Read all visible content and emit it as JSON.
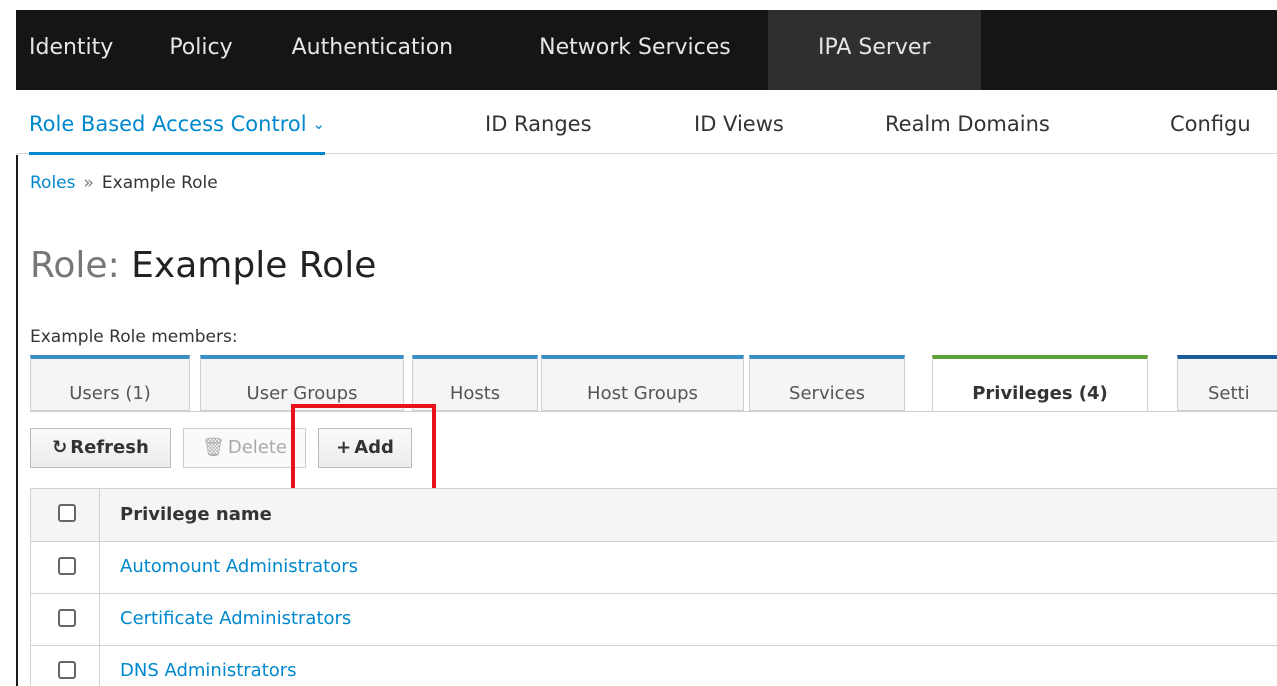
{
  "topnav": {
    "items": [
      {
        "label": "Identity"
      },
      {
        "label": "Policy"
      },
      {
        "label": "Authentication"
      },
      {
        "label": "Network Services"
      },
      {
        "label": "IPA Server"
      }
    ],
    "active": "IPA Server"
  },
  "subnav": {
    "items": [
      {
        "label": "Role Based Access Control"
      },
      {
        "label": "ID Ranges"
      },
      {
        "label": "ID Views"
      },
      {
        "label": "Realm Domains"
      },
      {
        "label": "Configu"
      }
    ],
    "active": "Role Based Access Control"
  },
  "breadcrumb": {
    "link": "Roles",
    "separator": "»",
    "current": "Example Role"
  },
  "title": {
    "prefix": "Role:",
    "name": "Example Role"
  },
  "members_label": "Example Role members:",
  "tabs": [
    {
      "label": "Users (1)"
    },
    {
      "label": "User Groups"
    },
    {
      "label": "Hosts"
    },
    {
      "label": "Host Groups"
    },
    {
      "label": "Services"
    },
    {
      "label": "Privileges (4)"
    },
    {
      "label": "Setti"
    }
  ],
  "active_tab": "Privileges (4)",
  "toolbar": {
    "refresh": "Refresh",
    "delete": "Delete",
    "add": "Add",
    "refresh_icon": "refresh-icon",
    "delete_icon": "trash-icon",
    "add_icon": "plus-icon"
  },
  "table": {
    "header": "Privilege name",
    "rows": [
      {
        "name": "Automount Administrators"
      },
      {
        "name": "Certificate Administrators"
      },
      {
        "name": "DNS Administrators"
      }
    ]
  },
  "colors": {
    "accent": "#0088ce",
    "highlight": "#e8121b",
    "active_tab_border": "#5fa238",
    "nav_bg": "#151515"
  }
}
